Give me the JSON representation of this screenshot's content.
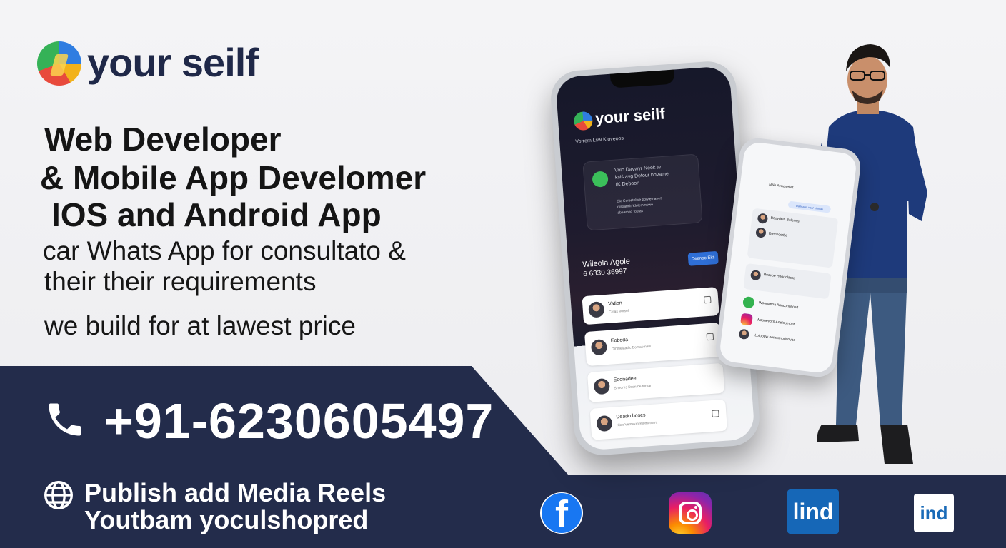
{
  "brand": {
    "name": "your seilf"
  },
  "headline": {
    "line1": "Web Developer",
    "line2": "& Mobile App Develomer",
    "line3": "IOS and Android App"
  },
  "description": {
    "line1": "car Whats App for consultato &",
    "line2": "their their requirements",
    "line3": "we build for at lawest price"
  },
  "contact": {
    "phone": "+91-6230605497"
  },
  "media": {
    "line1": "Publish add Media Reels",
    "line2": "Youtbam yoculshopred"
  },
  "social": {
    "facebook_glyph": "f",
    "linkedin_label": "lind",
    "indeed_label": "ind"
  },
  "phone_mockup": {
    "brand": "your seilf",
    "subtitle": "Vorrom Lsw Kloveoos",
    "card_line1": "Volo Davwyr Neek te",
    "card_line2": "ksiš avg Detour bovame",
    "card_line3": "(K Deboon",
    "card_line4": "Elo Corestoltve bowlemanes",
    "card_line5": "ooloamlir Klolemmowe",
    "card_line6": "abeamoo foutas",
    "contact_name": "Wileola Agole",
    "contact_number": "6 6330 36997",
    "button_label": "Deenoo Ekti",
    "rows": [
      {
        "name": "Vation",
        "sub": "Colas Vorsel"
      },
      {
        "name": "Eobdda",
        "sub": "Ommelaatlic Bomaomaw"
      },
      {
        "name": "Eoonadeer",
        "sub": "Sneoms Dssnme fomar"
      },
      {
        "name": "Deado boses",
        "sub": "Klen Vemekm Klomonevu"
      }
    ]
  },
  "tablet_mockup": {
    "header": "NNo Avnoneliet",
    "pill_label": "Daneaoo vaar kinnbo",
    "rows": [
      {
        "name": "Beovdeln Bolenes"
      },
      {
        "name": "Drensoerbe"
      },
      {
        "name": "Beavoe Heodolasas"
      },
      {
        "name": "Woonanoa Anaconceoalt"
      },
      {
        "name": "Woonevorn Aneloumbot"
      },
      {
        "name": "Lotoouw bomsnnoddoyae"
      }
    ]
  },
  "colors": {
    "navy": "#232c4b",
    "brand_text": "#1f2848",
    "facebook": "#1877f2",
    "linkedin": "#1667b7",
    "whatsapp": "#33b24f"
  }
}
